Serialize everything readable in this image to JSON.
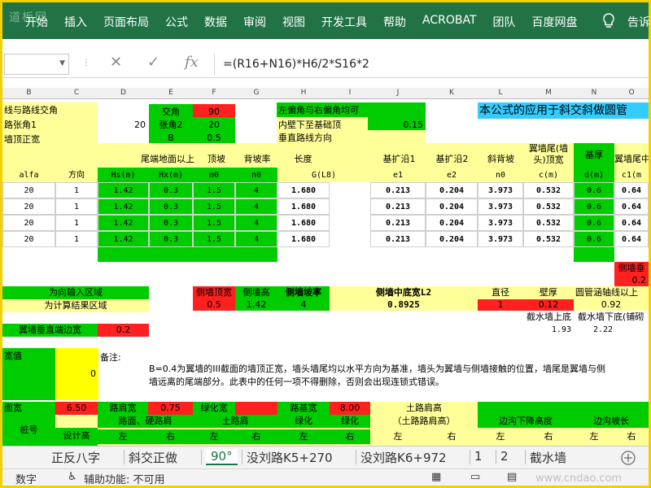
{
  "watermark_logo": "道板网",
  "ribbon": {
    "tabs": [
      "开始",
      "插入",
      "页面布局",
      "公式",
      "数据",
      "审阅",
      "视图",
      "开发工具",
      "帮助",
      "ACROBAT",
      "团队",
      "百度网盘"
    ],
    "tell_me": "告诉"
  },
  "formula_bar": {
    "formula": "=(R16+N16)*H6/2*S16*2"
  },
  "columns": [
    "B",
    "C",
    "D",
    "E",
    "F",
    "G",
    "H",
    "I",
    "J",
    "K",
    "L",
    "M",
    "N",
    "O"
  ],
  "top": {
    "r1_label": "线与路线交角",
    "r2_label": "路张角1",
    "r2_value": "20",
    "r3_label": "墙顶正宽",
    "jiaojiao_label": "交角",
    "jiaojiao_value": "90",
    "zhangjiao2_label": "张角2",
    "zhangjiao2_value": "20",
    "b_label": "B",
    "b_value": "0.5",
    "left_angle_note": "左偏角与右偏角均可",
    "inner_wall_label": "内壁下至基础顶",
    "inner_wall_value": "0.15",
    "perp_direction": "垂直路线方向",
    "banner": "本公式的应用于斜交斜做圆管"
  },
  "headers": {
    "wall_end_ground": "尾端地面以上",
    "top_slope": "顶坡",
    "back_slope": "背坡率",
    "length": "长度",
    "base_ext1": "基扩沿1",
    "base_ext2": "基扩沿2",
    "slant_slope": "斜背坡",
    "wing_tail_top": "翼墙尾(墙头)顶宽",
    "base_thick": "基厚",
    "wing_tail_cut": "翼墙尾中"
  },
  "subheaders": [
    "alfa",
    "方向",
    "Hs(m)",
    "Hx(m)",
    "m0",
    "n0",
    "G(L8)",
    "e1",
    "e2",
    "n0",
    "c(m)",
    "d(m)",
    "c1(m"
  ],
  "rows": [
    {
      "alfa": "20",
      "dir": "1",
      "hs": "1.42",
      "hx": "0.3",
      "m0": "1.5",
      "n0": "4",
      "g": "1.680",
      "e1": "0.213",
      "e2": "0.204",
      "n0b": "3.973",
      "c": "0.532",
      "d": "0.6",
      "c1": "0.64"
    },
    {
      "alfa": "20",
      "dir": "1",
      "hs": "1.42",
      "hx": "0.3",
      "m0": "1.5",
      "n0": "4",
      "g": "1.680",
      "e1": "0.213",
      "e2": "0.204",
      "n0b": "3.973",
      "c": "0.532",
      "d": "0.6",
      "c1": "0.64"
    },
    {
      "alfa": "20",
      "dir": "1",
      "hs": "1.42",
      "hx": "0.3",
      "m0": "1.5",
      "n0": "4",
      "g": "1.680",
      "e1": "0.213",
      "e2": "0.204",
      "n0b": "3.973",
      "c": "0.532",
      "d": "0.6",
      "c1": "0.64"
    },
    {
      "alfa": "20",
      "dir": "1",
      "hs": "1.42",
      "hx": "0.3",
      "m0": "1.5",
      "n0": "4",
      "g": "1.680",
      "e1": "0.213",
      "e2": "0.204",
      "n0b": "3.973",
      "c": "0.532",
      "d": "0.6",
      "c1": "0.64"
    }
  ],
  "side_wall_pr": "侧墙垂",
  "side_wall_val": "0.2",
  "legend": {
    "input": "为向输入区域",
    "output": "为计算结果区域"
  },
  "mid": {
    "side_top_width_label": "侧墙顶宽",
    "side_top_width": "0.5",
    "side_height_label": "侧墙高",
    "side_height": "1.42",
    "side_slope_label": "侧墙坡率",
    "side_slope": "4",
    "side_bottom_label": "侧墙中底宽L2",
    "side_bottom": "0.8925",
    "diameter_label": "直径",
    "diameter": "1",
    "wall_thick_label": "壁厚",
    "wall_thick": "0.12",
    "culvert_axis_label": "圆管涵轴线以上",
    "culvert_axis": "0.92",
    "cut_top_label": "截水墙上底",
    "cut_top": "1.93",
    "cut_bottom_label": "截水墙下底(铺砌",
    "cut_bottom": "2.22"
  },
  "wing_vertical": {
    "label": "翼墙垂直端边宽",
    "value": "0.2"
  },
  "width_value": {
    "label": "宽值",
    "value": "0",
    "note_label": "备注:",
    "note": "B=0.4为翼墙的III截面的墙顶正宽，墙头墙尾均以水平方向为基准，墙头为翼墙与侧墙接触的位置，墙尾是翼墙与侧墙远离的尾端部分。此表中的任何一项不得删除，否则会出现连锁式错误。"
  },
  "road": {
    "surface_label": "面宽",
    "surface": "6.50",
    "shoulder_label": "路肩宽",
    "shoulder": "0.75",
    "green_label": "绿化宽",
    "subgrade_label": "路基宽",
    "subgrade": "8.00",
    "earth_height": "土路肩高",
    "earth_height2": "（土路路肩高）",
    "side_ditch_drop": "边沟下降高度",
    "side_ditch_slope": "边沟坡长"
  },
  "bottom_headers": {
    "pile": "桩号",
    "design_height": "设计高",
    "road_shoulder": "路面、硬路肩",
    "soil_shoulder": "土路肩",
    "green1": "绿化",
    "green2": "绿化",
    "left": "左",
    "right": "右"
  },
  "sheet_tabs": [
    "正反八字",
    "斜交正做",
    "90°",
    "没刘路K5+270",
    "没刘路K6+972",
    "1",
    "2",
    "截水墙"
  ],
  "active_tab": "90°",
  "status": {
    "mode": "数字",
    "accessibility": "辅助功能: 不可用"
  },
  "footer_watermark": "www.cndao.com",
  "colors": {
    "ribbon": "#217346",
    "input_green": "#00cc00",
    "output_yellow": "#ffff99",
    "red": "#ff2020",
    "cyan": "#33ccff"
  }
}
